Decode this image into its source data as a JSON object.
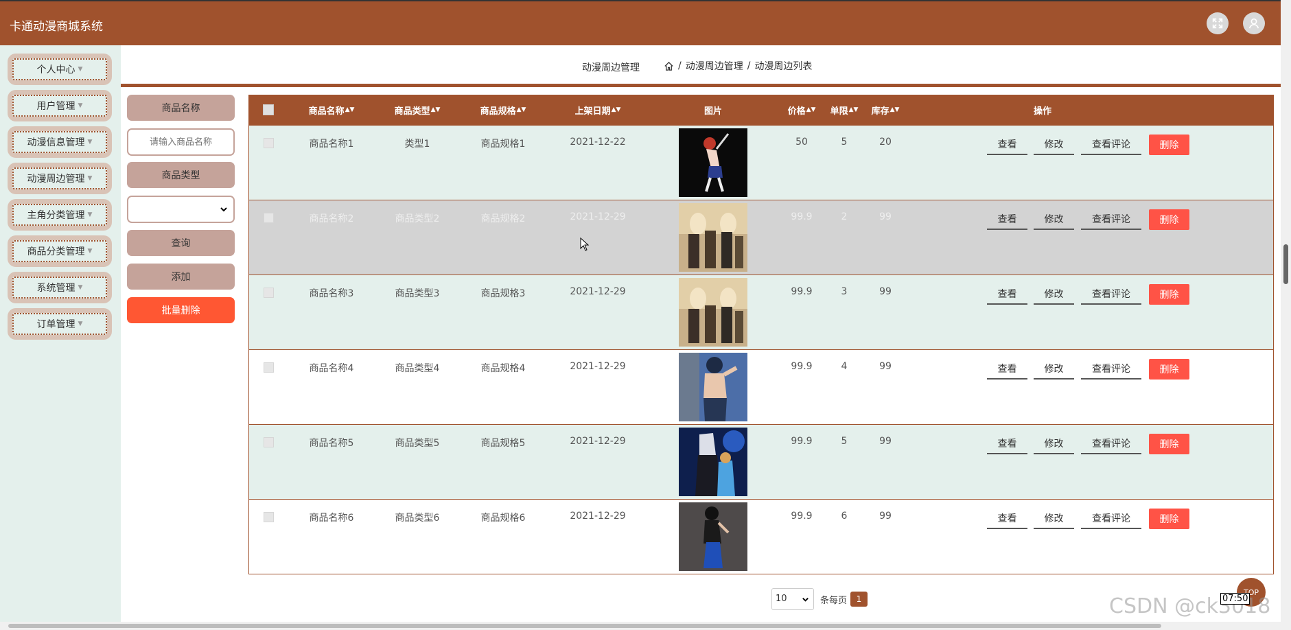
{
  "header": {
    "app_title": "卡通动漫商城系统",
    "fullscreen_icon": "expand-icon",
    "user_icon": "user-icon"
  },
  "sidebar": {
    "items": [
      {
        "label": "个人中心"
      },
      {
        "label": "用户管理"
      },
      {
        "label": "动漫信息管理"
      },
      {
        "label": "动漫周边管理"
      },
      {
        "label": "主角分类管理"
      },
      {
        "label": "商品分类管理"
      },
      {
        "label": "系统管理"
      },
      {
        "label": "订单管理"
      }
    ]
  },
  "breadcrumb": {
    "section": "动漫周边管理",
    "home_icon": "home-icon",
    "level1": "动漫周边管理",
    "level2": "动漫周边列表",
    "separator": "/"
  },
  "search": {
    "name_label": "商品名称",
    "name_placeholder": "请输入商品名称",
    "type_label": "商品类型",
    "type_selected": "",
    "query_button": "查询",
    "add_button": "添加",
    "batch_delete_button": "批量删除"
  },
  "table": {
    "columns": {
      "name": "商品名称",
      "type": "商品类型",
      "spec": "商品规格",
      "date": "上架日期",
      "image": "图片",
      "price": "价格",
      "limit": "单限",
      "stock": "库存",
      "actions": "操作"
    },
    "action_labels": {
      "view": "查看",
      "edit": "修改",
      "comments": "查看评论",
      "delete": "删除"
    },
    "rows": [
      {
        "name": "商品名称1",
        "type": "类型1",
        "spec": "商品规格1",
        "date": "2021-12-22",
        "price": "50",
        "limit": "5",
        "stock": "20"
      },
      {
        "name": "商品名称2",
        "type": "商品类型2",
        "spec": "商品规格2",
        "date": "2021-12-29",
        "price": "99.9",
        "limit": "2",
        "stock": "99"
      },
      {
        "name": "商品名称3",
        "type": "商品类型3",
        "spec": "商品规格3",
        "date": "2021-12-29",
        "price": "99.9",
        "limit": "3",
        "stock": "99"
      },
      {
        "name": "商品名称4",
        "type": "商品类型4",
        "spec": "商品规格4",
        "date": "2021-12-29",
        "price": "99.9",
        "limit": "4",
        "stock": "99"
      },
      {
        "name": "商品名称5",
        "type": "商品类型5",
        "spec": "商品规格5",
        "date": "2021-12-29",
        "price": "99.9",
        "limit": "5",
        "stock": "99"
      },
      {
        "name": "商品名称6",
        "type": "商品类型6",
        "spec": "商品规格6",
        "date": "2021-12-29",
        "price": "99.9",
        "limit": "6",
        "stock": "99"
      }
    ]
  },
  "pagination": {
    "page_size": "10",
    "per_page_text": "条每页",
    "current_page": "1"
  },
  "overlay": {
    "clock": "07:50",
    "watermark": "CSDN @ck3018",
    "top_button": "TOP"
  },
  "colors": {
    "brand": "#a0522d",
    "sidebar_bg": "#e4f0ec",
    "danger": "#ff5346",
    "muted_button": "#c5a39a"
  }
}
